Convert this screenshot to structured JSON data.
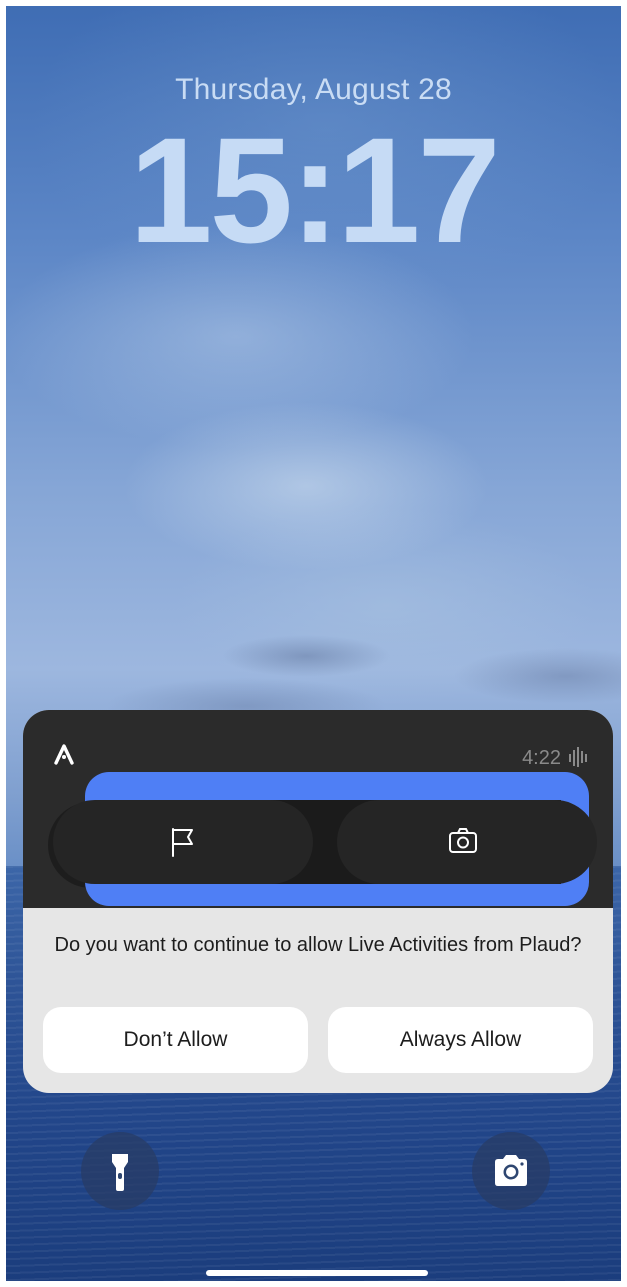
{
  "lockscreen": {
    "date": "Thursday, August 28",
    "time": "15:17"
  },
  "live_activity": {
    "app_logo": "A",
    "duration": "4:22",
    "wave_icon": "waveform-icon",
    "flag_icon": "flag-icon",
    "camera_icon": "camera-icon"
  },
  "prompt": {
    "text": "Do you want to continue to allow Live Activities from Plaud?",
    "dont_allow_label": "Don’t Allow",
    "always_allow_label": "Always Allow"
  },
  "controls": {
    "flashlight_icon": "flashlight-icon",
    "camera_icon": "camera-icon"
  },
  "colors": {
    "highlight": "#4f7ff5",
    "card_dark": "#2b2b2b",
    "card_light": "#e6e6e6"
  }
}
